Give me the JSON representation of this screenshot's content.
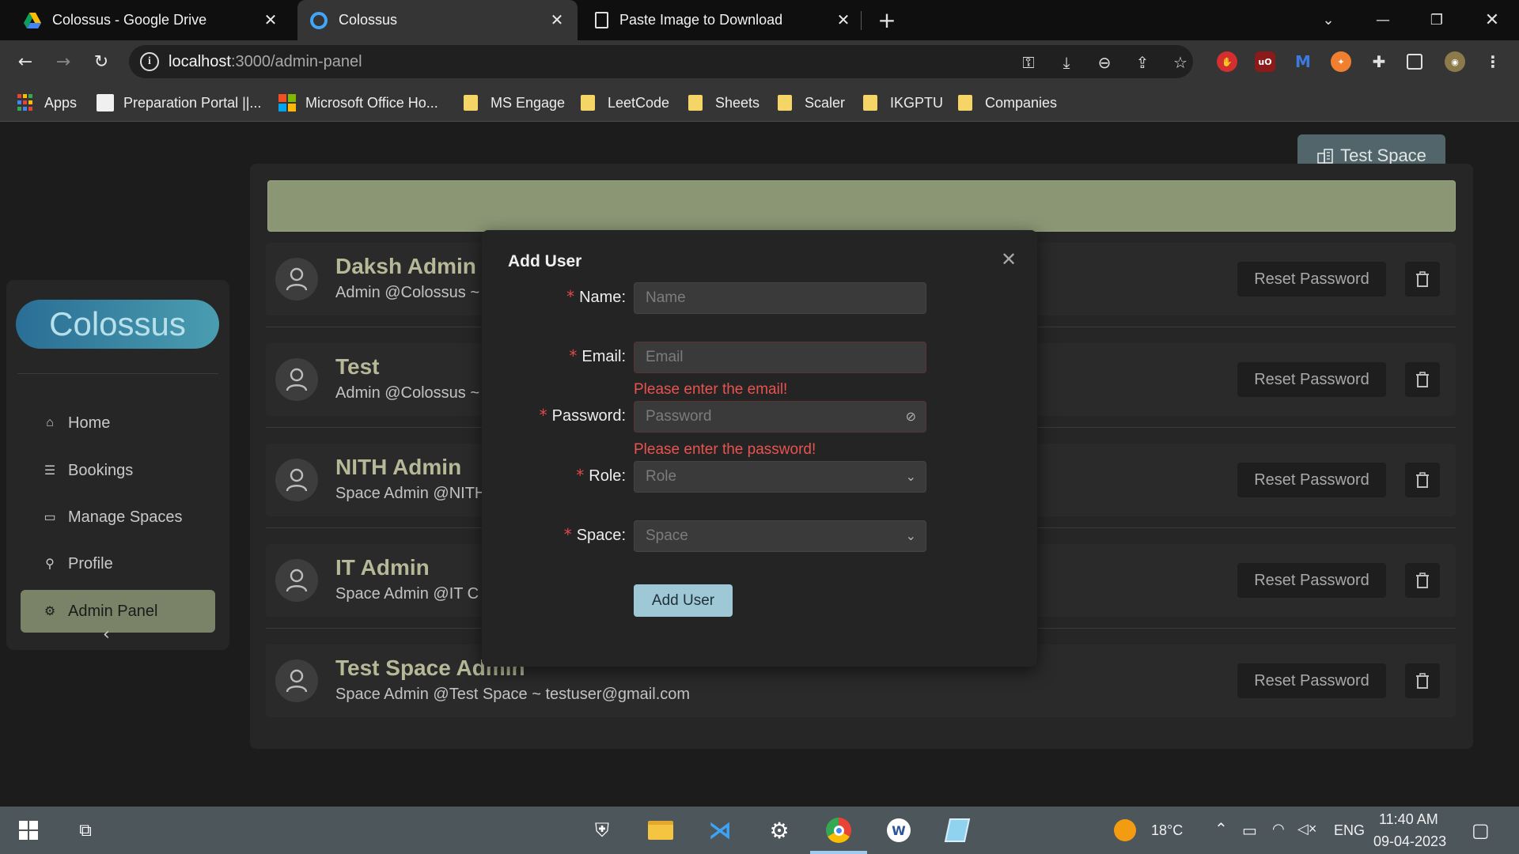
{
  "browser": {
    "tabs": [
      {
        "title": "Colossus - Google Drive",
        "active": false
      },
      {
        "title": "Colossus",
        "active": true
      },
      {
        "title": "Paste Image to Download",
        "active": false
      }
    ],
    "url_host": "localhost",
    "url_path": ":3000/admin-panel",
    "bookmarks": [
      {
        "label": "Apps"
      },
      {
        "label": "Preparation Portal ||..."
      },
      {
        "label": "Microsoft Office Ho..."
      },
      {
        "label": "MS Engage"
      },
      {
        "label": "LeetCode"
      },
      {
        "label": "Sheets"
      },
      {
        "label": "Scaler"
      },
      {
        "label": "IKGPTU"
      },
      {
        "label": "Companies"
      }
    ]
  },
  "header": {
    "space_button": "Test Space"
  },
  "sidebar": {
    "logo": "Colossus",
    "items": [
      {
        "label": "Home",
        "icon": "home-icon",
        "selected": false
      },
      {
        "label": "Bookings",
        "icon": "list-icon",
        "selected": false
      },
      {
        "label": "Manage Spaces",
        "icon": "desktop-icon",
        "selected": false
      },
      {
        "label": "Profile",
        "icon": "user-icon",
        "selected": false
      },
      {
        "label": "Admin Panel",
        "icon": "gear-icon",
        "selected": true
      }
    ]
  },
  "users": [
    {
      "name": "Daksh Admin",
      "sub": "Admin @Colossus ~"
    },
    {
      "name": "Test",
      "sub": "Admin @Colossus ~"
    },
    {
      "name": "NITH Admin",
      "sub": "Space Admin @NITH"
    },
    {
      "name": "IT Admin",
      "sub": "Space Admin @IT C"
    },
    {
      "name": "Test Space Admin",
      "sub": "Space Admin @Test Space ~ testuser@gmail.com"
    }
  ],
  "row_actions": {
    "reset_label": "Reset Password"
  },
  "modal": {
    "title": "Add User",
    "fields": {
      "name": {
        "label": "Name",
        "placeholder": "Name"
      },
      "email": {
        "label": "Email",
        "placeholder": "Email",
        "error": "Please enter the email!"
      },
      "password": {
        "label": "Password",
        "placeholder": "Password",
        "error": "Please enter the password!"
      },
      "role": {
        "label": "Role",
        "placeholder": "Role"
      },
      "space": {
        "label": "Space",
        "placeholder": "Space"
      }
    },
    "submit_label": "Add User"
  },
  "taskbar": {
    "weather": "18°C",
    "language": "ENG",
    "time": "11:40 AM",
    "date": "09-04-2023"
  },
  "colors": {
    "accent": "#9ec8d6",
    "selected_menu": "#7a8367",
    "banner": "#8b9675",
    "error": "#e8534f"
  }
}
